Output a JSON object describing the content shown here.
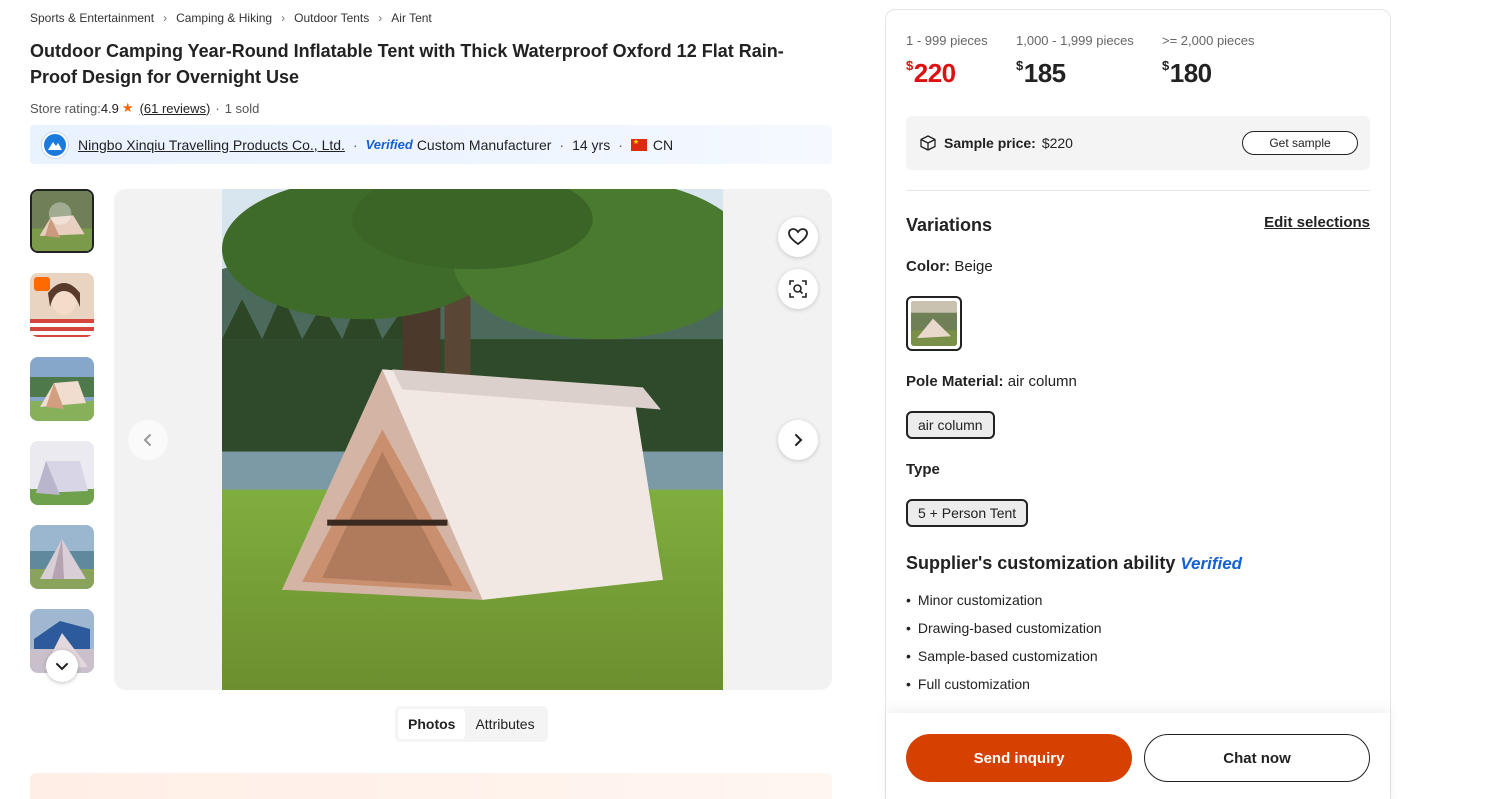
{
  "breadcrumb": [
    "Sports & Entertainment",
    "Camping & Hiking",
    "Outdoor Tents",
    "Air Tent"
  ],
  "product": {
    "title": "Outdoor Camping Year-Round Inflatable Tent with Thick Waterproof Oxford 12 Flat Rain-Proof Design for Overnight Use",
    "rating_label": "Store rating:",
    "rating_value": "4.9",
    "reviews": "(61 reviews)",
    "sold": "1 sold"
  },
  "supplier": {
    "name": "Ningbo Xinqiu Travelling Products Co., Ltd.",
    "verified": "Verified",
    "type": "Custom Manufacturer",
    "years": "14 yrs",
    "country": "CN"
  },
  "gallery": {
    "tabs": [
      "Photos",
      "Attributes"
    ],
    "active_tab": "Photos"
  },
  "pricing": {
    "tiers": [
      {
        "range": "1 - 999 pieces",
        "currency": "$",
        "price": "220"
      },
      {
        "range": "1,000 - 1,999 pieces",
        "currency": "$",
        "price": "185"
      },
      {
        "range": ">= 2,000 pieces",
        "currency": "$",
        "price": "180"
      }
    ],
    "sample_label": "Sample price:",
    "sample_price": "$220",
    "get_sample": "Get sample"
  },
  "variations": {
    "title": "Variations",
    "edit": "Edit selections",
    "color_label": "Color:",
    "color_value": "Beige",
    "pole_label": "Pole Material:",
    "pole_value": "air column",
    "pole_option": "air column",
    "type_label": "Type",
    "type_option": "5 + Person Tent"
  },
  "customization": {
    "title": "Supplier's customization ability",
    "verified": "Verified",
    "items": [
      "Minor customization",
      "Drawing-based customization",
      "Sample-based customization",
      "Full customization"
    ]
  },
  "actions": {
    "inquiry": "Send inquiry",
    "chat": "Chat now"
  },
  "colors": {
    "accent": "#d64000",
    "price_red": "#dd1111",
    "verified_blue": "#1560d4",
    "star": "#ff6600"
  }
}
